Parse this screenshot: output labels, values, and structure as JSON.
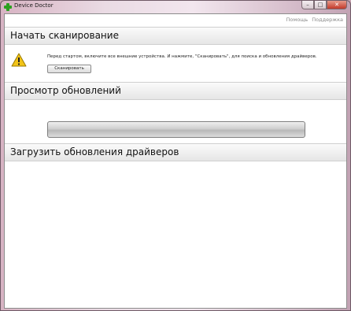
{
  "window": {
    "title": "Device Doctor",
    "min_label": "–",
    "max_label": "□",
    "close_label": "✕"
  },
  "toplinks": {
    "help": "Помощь",
    "support": "Поддержка"
  },
  "sections": {
    "scan": {
      "title": "Начать сканирование",
      "message": "Перед стартом, включите все внешние устройства. И нажмите, \"Сканировать\", для поиска и обновления драйверов.",
      "button_label": "Сканировать",
      "icon": "warning-icon"
    },
    "updates": {
      "title": "Просмотр обновлений",
      "progress": 0
    },
    "download": {
      "title": "Загрузить обновления драйверов"
    }
  },
  "colors": {
    "app_icon": "#2aa11f",
    "warning": "#f2c418"
  }
}
